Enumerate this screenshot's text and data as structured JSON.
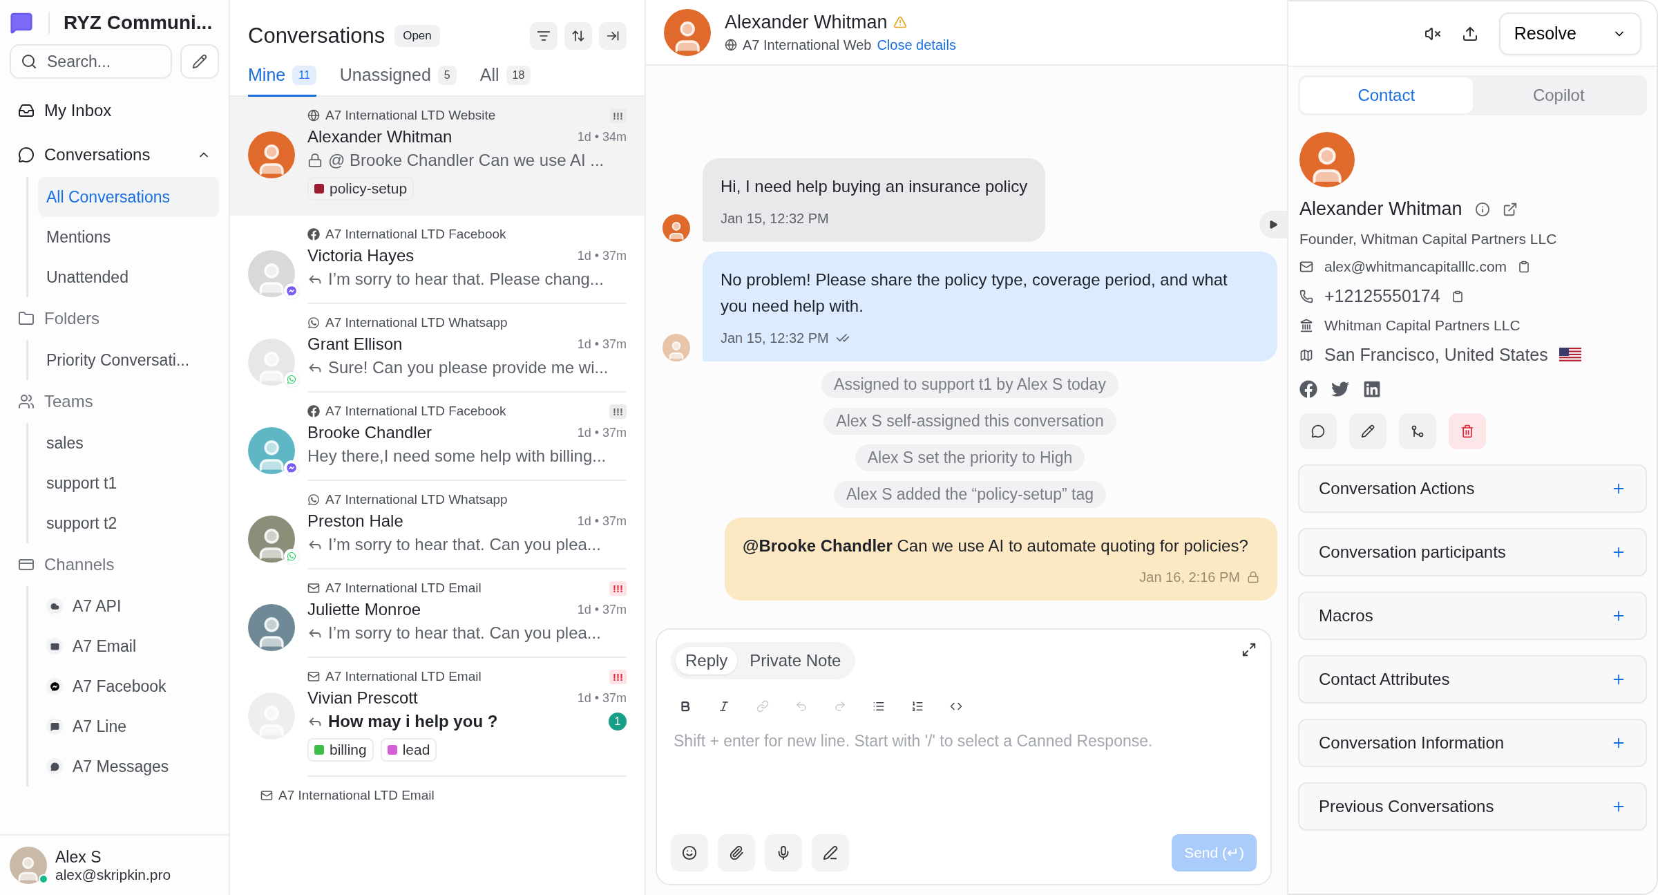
{
  "workspace": {
    "name": "RYZ Communi..."
  },
  "sidebar": {
    "search": {
      "placeholder": "Search..."
    },
    "nav": [
      {
        "kind": "link",
        "label": "My Inbox"
      },
      {
        "kind": "collapsible",
        "label": "Conversations",
        "expanded": true,
        "children": [
          {
            "label": "All Conversations",
            "selected": true
          },
          {
            "label": "Mentions",
            "selected": false
          },
          {
            "label": "Unattended",
            "selected": false
          }
        ]
      },
      {
        "kind": "group",
        "label": "Folders",
        "children": [
          {
            "label": "Priority Conversati...",
            "selected": false
          }
        ]
      },
      {
        "kind": "group",
        "label": "Teams",
        "children": [
          {
            "label": "sales",
            "selected": false
          },
          {
            "label": "support t1",
            "selected": false
          },
          {
            "label": "support t2",
            "selected": false
          }
        ]
      },
      {
        "kind": "group",
        "label": "Channels",
        "children": [
          {
            "label": "A7 API",
            "selected": false,
            "kind": "api"
          },
          {
            "label": "A7 Email",
            "selected": false,
            "kind": "email"
          },
          {
            "label": "A7 Facebook",
            "selected": false,
            "kind": "facebook"
          },
          {
            "label": "A7 Line",
            "selected": false,
            "kind": "line"
          },
          {
            "label": "A7 Messages",
            "selected": false,
            "kind": "messages"
          }
        ]
      }
    ],
    "user": {
      "name": "Alex S",
      "email": "alex@skripkin.pro",
      "online": true
    }
  },
  "conversation_list": {
    "title": "Conversations",
    "status": "Open",
    "tabs": [
      {
        "label": "Mine",
        "count": "11",
        "selected": true
      },
      {
        "label": "Unassigned",
        "count": "5",
        "selected": false
      },
      {
        "label": "All",
        "count": "18",
        "selected": false
      }
    ],
    "items": [
      {
        "selected": true,
        "kind": "website",
        "inbox": "A7 International LTD Website",
        "priority": {
          "label": "!!!",
          "urgent": false
        },
        "name": "Alexander Whitman",
        "time": "1d • 34m",
        "private": true,
        "replied": false,
        "preview": "@ Brooke Chandler Can we use AI ...",
        "labels": [
          {
            "name": "policy-setup",
            "color": "#9b1c31"
          }
        ]
      },
      {
        "selected": false,
        "kind": "facebook",
        "inbox": "A7 International LTD Facebook",
        "name": "Victoria Hayes",
        "time": "1d • 37m",
        "private": false,
        "replied": true,
        "preview": "I’m sorry to hear that. Please chang..."
      },
      {
        "selected": false,
        "kind": "whatsapp",
        "inbox": "A7 International LTD Whatsapp",
        "name": "Grant Ellison",
        "time": "1d • 37m",
        "private": false,
        "replied": true,
        "preview": "Sure! Can you please provide me wi..."
      },
      {
        "selected": false,
        "kind": "facebook",
        "inbox": "A7 International LTD Facebook",
        "priority": {
          "label": "!!!",
          "urgent": false
        },
        "name": "Brooke Chandler",
        "time": "1d • 37m",
        "private": false,
        "replied": false,
        "preview": "Hey there,I need some help with billing..."
      },
      {
        "selected": false,
        "kind": "whatsapp",
        "inbox": "A7 International LTD Whatsapp",
        "name": "Preston Hale",
        "time": "1d • 37m",
        "private": false,
        "replied": true,
        "preview": "I’m sorry to hear that. Can you plea..."
      },
      {
        "selected": false,
        "kind": "email",
        "inbox": "A7 International LTD Email",
        "priority": {
          "label": "!!!",
          "urgent": true
        },
        "name": "Juliette Monroe",
        "time": "1d • 37m",
        "private": false,
        "replied": true,
        "preview": "I’m sorry to hear that. Can you plea..."
      },
      {
        "selected": false,
        "kind": "email",
        "inbox": "A7 International LTD Email",
        "priority": {
          "label": "!!!",
          "urgent": true
        },
        "name": "Vivian Prescott",
        "time": "1d • 37m",
        "private": false,
        "replied": true,
        "preview": "How may i help you ?",
        "unread": "1",
        "labels": [
          {
            "name": "billing",
            "color": "#3dbd4a"
          },
          {
            "name": "lead",
            "color": "#d65fd8"
          }
        ]
      },
      {
        "selected": false,
        "kind": "email",
        "inbox": "A7 International LTD Email"
      }
    ]
  },
  "conversation": {
    "contact_name": "Alexander Whitman",
    "warning": true,
    "inbox": "A7 International Web",
    "close_link": "Close details",
    "resolve": "Resolve",
    "messages": [
      {
        "kind": "incoming",
        "text": "Hi, I need help buying an insurance policy",
        "time": "Jan 15, 12:32 PM"
      },
      {
        "kind": "outgoing",
        "text": "No problem! Please share the policy type, coverage period, and what you need help with.",
        "time": "Jan 15, 12:32 PM",
        "read": true
      },
      {
        "kind": "activity",
        "text": "Assigned to support t1 by Alex S today"
      },
      {
        "kind": "activity",
        "text": "Alex S self-assigned this conversation"
      },
      {
        "kind": "activity",
        "text": "Alex S set the priority to High"
      },
      {
        "kind": "activity",
        "text": "Alex S added the “policy-setup” tag"
      },
      {
        "kind": "private",
        "text": "**@Brooke Chandler** Can we use AI to automate quoting for policies?",
        "time": "Jan 16, 2:16 PM"
      }
    ],
    "composer": {
      "modes": [
        {
          "label": "Reply",
          "selected": true
        },
        {
          "label": "Private Note",
          "selected": false
        }
      ],
      "tools": [
        {
          "kind": "bold",
          "disabled": false
        },
        {
          "kind": "italic",
          "disabled": false
        },
        {
          "kind": "link",
          "disabled": true
        },
        {
          "kind": "undo",
          "disabled": true
        },
        {
          "kind": "redo",
          "disabled": true
        },
        {
          "kind": "bullets",
          "disabled": false
        },
        {
          "kind": "numbers",
          "disabled": false
        },
        {
          "kind": "code",
          "disabled": false
        }
      ],
      "placeholder": "Shift + enter for new line. Start with '/' to select a Canned Response.",
      "send": {
        "label": "Send (↵)",
        "disabled": true
      }
    }
  },
  "details": {
    "tabs": [
      {
        "label": "Contact",
        "selected": true
      },
      {
        "label": "Copilot",
        "selected": false
      }
    ],
    "contact": {
      "name": "Alexander Whitman",
      "title": "Founder, Whitman Capital Partners LLC",
      "fields": [
        {
          "kind": "email",
          "value": "alex@whitmancapitalllc.com",
          "copyable": true
        },
        {
          "kind": "phone",
          "value": "+12125550174",
          "copyable": true
        },
        {
          "kind": "company",
          "value": "Whitman Capital Partners LLC",
          "copyable": false
        },
        {
          "kind": "location",
          "value": "San Francisco, United States",
          "copyable": false
        }
      ]
    },
    "sections": [
      {
        "title": "Conversation Actions",
        "expanded": false
      },
      {
        "title": "Conversation participants",
        "expanded": false
      },
      {
        "title": "Macros",
        "expanded": false
      },
      {
        "title": "Contact Attributes",
        "expanded": false
      },
      {
        "title": "Conversation Information",
        "expanded": false
      },
      {
        "title": "Previous Conversations",
        "expanded": false
      }
    ]
  }
}
